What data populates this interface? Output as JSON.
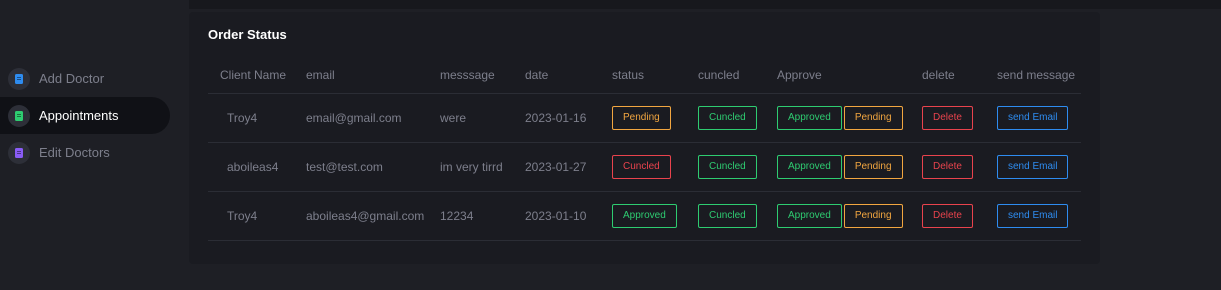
{
  "sidebar": {
    "items": [
      {
        "label": "Add Doctor",
        "icon": "doctor-icon",
        "color": "#2e8cf0",
        "active": false
      },
      {
        "label": "Appointments",
        "icon": "calendar-icon",
        "color": "#2ecc71",
        "active": true
      },
      {
        "label": "Edit Doctors",
        "icon": "edit-icon",
        "color": "#8a5cf6",
        "active": false
      }
    ]
  },
  "card": {
    "title": "Order Status",
    "columns": [
      "Client Name",
      "email",
      "messsage",
      "date",
      "status",
      "cuncled",
      "Approve",
      "delete",
      "send message"
    ],
    "rows": [
      {
        "client": "Troy4",
        "email": "email@gmail.com",
        "message": "were",
        "date": "2023-01-16",
        "status": "Pending",
        "cuncled": "Cuncled",
        "approve": "Approved",
        "pending": "Pending",
        "delete": "Delete",
        "send": "send Email"
      },
      {
        "client": "aboileas4",
        "email": "test@test.com",
        "message": "im very tirrd",
        "date": "2023-01-27",
        "status": "Cuncled",
        "cuncled": "Cuncled",
        "approve": "Approved",
        "pending": "Pending",
        "delete": "Delete",
        "send": "send Email"
      },
      {
        "client": "Troy4",
        "email": "aboileas4@gmail.com",
        "message": "12234",
        "date": "2023-01-10",
        "status": "Approved",
        "cuncled": "Cuncled",
        "approve": "Approved",
        "pending": "Pending",
        "delete": "Delete",
        "send": "send Email"
      }
    ]
  },
  "colors": {
    "pending": "#f2a640",
    "approved": "#2ecc71",
    "cuncled": "#e9434d",
    "delete": "#e9434d",
    "send": "#2e8cf0"
  }
}
